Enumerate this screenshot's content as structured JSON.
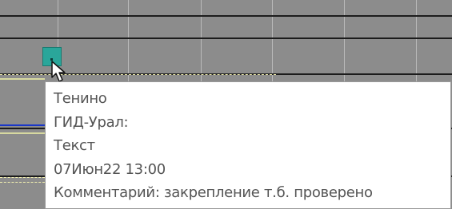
{
  "tooltip": {
    "lines": [
      "Тенино",
      "ГИД-Урал:",
      "Текст",
      "07Июн22 13:00",
      "Комментарий: закрепление т.б. проверено"
    ]
  },
  "marker": {
    "icon": "train-marker-icon",
    "color": "#2aa69a"
  },
  "cursor": {
    "icon": "arrow-cursor-icon"
  },
  "colors": {
    "grid_background": "#8c8c8c",
    "grid_line": "#1c1c1c",
    "track_line": "#f3f1b0",
    "blue_line": "#1a37c8",
    "tooltip_background": "#ffffff",
    "tooltip_text": "#555555"
  }
}
